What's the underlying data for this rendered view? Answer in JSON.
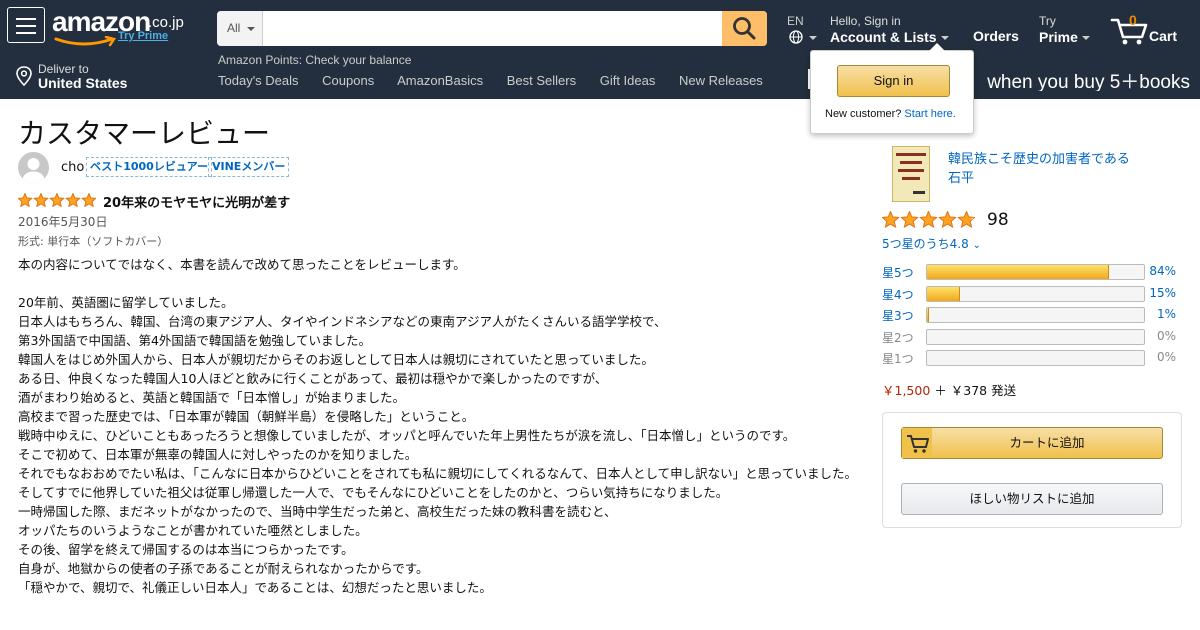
{
  "header": {
    "logo_text": "amazon",
    "logo_tld": ".co.jp",
    "try_prime_link": "Try Prime",
    "search": {
      "category": "All",
      "placeholder": "",
      "value": ""
    },
    "language": "EN",
    "account_greeting": "Hello, Sign in",
    "account_label": "Account & Lists",
    "orders_label": "Orders",
    "try_label": "Try",
    "prime_label": "Prime",
    "cart_count": "0",
    "cart_label": "Cart",
    "deliver_line1": "Deliver to",
    "deliver_line2": "United States",
    "points_label": "Amazon Points",
    "points_action": "Check your balance",
    "nav_links": [
      "Today's Deals",
      "Coupons",
      "AmazonBasics",
      "Best Sellers",
      "Gift Ideas",
      "New Releases"
    ],
    "promo_text": "when you buy 5＋books"
  },
  "signin_flyout": {
    "button_label": "Sign in",
    "new_customer": "New customer?",
    "start_here": "Start here."
  },
  "review": {
    "page_title": "カスタマーレビュー",
    "reviewer_name": "cho",
    "badges": [
      "ベスト1000レビュアー",
      "VINEメンバー"
    ],
    "rating": 5,
    "title": "20年来のモヤモヤに光明が差す",
    "date": "2016年5月30日",
    "format": "形式: 単行本（ソフトカバー）",
    "body": [
      "本の内容についてではなく、本書を読んで改めて思ったことをレビューします。",
      "",
      "20年前、英語圏に留学していました。",
      "日本人はもちろん、韓国、台湾の東アジア人、タイやインドネシアなどの東南アジア人がたくさんいる語学学校で、",
      "第3外国語で中国語、第4外国語で韓国語を勉強していました。",
      "韓国人をはじめ外国人から、日本人が親切だからそのお返しとして日本人は親切にされていたと思っていました。",
      "ある日、仲良くなった韓国人10人ほどと飲みに行くことがあって、最初は穏やかで楽しかったのですが、",
      "酒がまわり始めると、英語と韓国語で「日本憎し」が始まりました。",
      "高校まで習った歴史では、「日本軍が韓国（朝鮮半島）を侵略した」ということ。",
      "戦時中ゆえに、ひどいこともあったろうと想像していましたが、オッパと呼んでいた年上男性たちが涙を流し、「日本憎し」というのです。",
      "そこで初めて、日本軍が無辜の韓国人に対しやったのかを知りました。",
      "それでもなおおめでたい私は、「こんなに日本からひどいことをされても私に親切にしてくれるなんて、日本人として申し訳ない」と思っていました。",
      "そしてすでに他界していた祖父は従軍し帰還した一人で、でもそんなにひどいことをしたのかと、つらい気持ちになりました。",
      "一時帰国した際、まだネットがなかったので、当時中学生だった弟と、高校生だった妹の教科書を読むと、",
      "オッパたちのいうようなことが書かれていた唖然としました。",
      "その後、留学を終えて帰国するのは本当につらかったです。",
      "自身が、地獄からの使者の子孫であることが耐えられなかったからです。",
      "「穏やかで、親切で、礼儀正しい日本人」であることは、幻想だったと思いました。"
    ]
  },
  "product": {
    "title": "韓民族こそ歴史の加害者である",
    "author": "石平",
    "rating_stars": 4.8,
    "review_count": "98",
    "average_text": "5つ星のうち4.8",
    "histogram": [
      {
        "label": "星5つ",
        "percent": 84,
        "pct_text": "84%"
      },
      {
        "label": "星4つ",
        "percent": 15,
        "pct_text": "15%"
      },
      {
        "label": "星3つ",
        "percent": 1,
        "pct_text": "1%"
      },
      {
        "label": "星2つ",
        "percent": 0,
        "pct_text": "0%"
      },
      {
        "label": "星1つ",
        "percent": 0,
        "pct_text": "0%"
      }
    ],
    "price": "￥1,500",
    "shipping": "＋ ￥378 発送",
    "add_to_cart": "カートに追加",
    "add_to_wishlist": "ほしい物リストに追加"
  },
  "colors": {
    "nav_bg": "#232f3e",
    "search_button": "#febd69",
    "link": "#0066c0",
    "star": "#ffa41c",
    "price": "#b12704"
  }
}
